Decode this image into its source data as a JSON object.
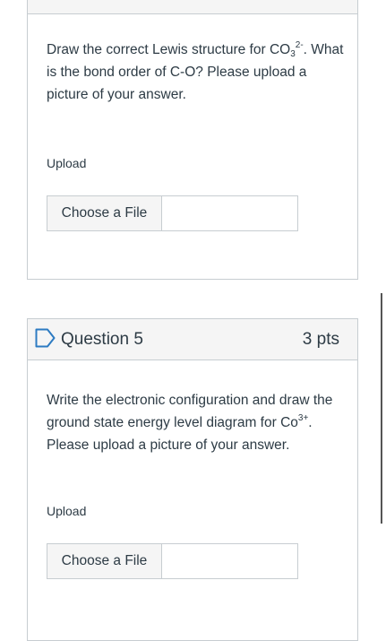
{
  "question4": {
    "text_prefix": "Draw the correct Lewis structure for CO",
    "text_sub": "3",
    "text_sup": "2-",
    "text_suffix": ". What is the bond order of C-O? Please upload a picture of your answer.",
    "upload_label": "Upload",
    "choose_file_label": "Choose a File"
  },
  "question5": {
    "title": "Question 5",
    "points": "3 pts",
    "text_prefix": "Write the electronic configuration and draw the ground state energy level diagram for Co",
    "text_sup": "3+",
    "text_suffix": ". Please upload a picture of your answer.",
    "upload_label": "Upload",
    "choose_file_label": "Choose a File"
  },
  "colors": {
    "accent": "#2d7bc2",
    "border": "#c7cdd1",
    "text": "#2d3b45"
  },
  "icons": {
    "flag": "bookmark-flag-icon"
  }
}
